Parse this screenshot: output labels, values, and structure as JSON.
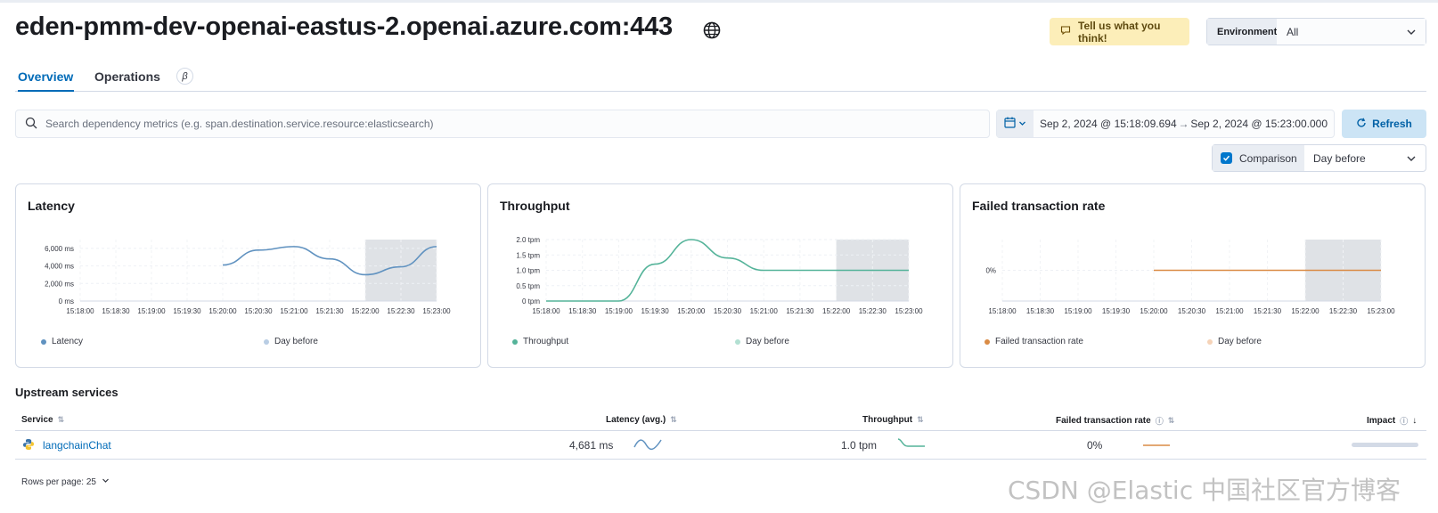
{
  "header": {
    "title": "eden-pmm-dev-openai-eastus-2.openai.azure.com:443",
    "feedback_label": "Tell us what you think!",
    "environment_label": "Environment",
    "environment_value": "All"
  },
  "tabs": [
    {
      "label": "Overview",
      "active": true
    },
    {
      "label": "Operations",
      "badge": "β"
    }
  ],
  "search": {
    "placeholder": "Search dependency metrics (e.g. span.destination.service.resource:elasticsearch)"
  },
  "date_range": {
    "start": "Sep 2, 2024 @ 15:18:09.694",
    "arrow": "→",
    "end": "Sep 2, 2024 @ 15:23:00.000"
  },
  "refresh_label": "Refresh",
  "comparison": {
    "label": "Comparison",
    "checked": true,
    "value": "Day before"
  },
  "chart_data": [
    {
      "type": "line",
      "title": "Latency",
      "x": [
        "15:18:00",
        "15:18:30",
        "15:19:00",
        "15:19:30",
        "15:20:00",
        "15:20:30",
        "15:21:00",
        "15:21:30",
        "15:22:00",
        "15:22:30",
        "15:23:00"
      ],
      "y_ticks": [
        "6,000 ms",
        "4,000 ms",
        "2,000 ms",
        "0 ms"
      ],
      "ylim": [
        0,
        7000
      ],
      "series": [
        {
          "name": "Latency",
          "color": "#6092c0",
          "points": [
            [
              4.0,
              4100
            ],
            [
              5.0,
              5800
            ],
            [
              6.0,
              6200
            ],
            [
              7.0,
              4800
            ],
            [
              8.0,
              3000
            ],
            [
              9.0,
              3900
            ],
            [
              10.0,
              6200
            ]
          ]
        },
        {
          "name": "Day before",
          "color": "#b9cde4",
          "points": []
        }
      ],
      "shaded_from": 8.0
    },
    {
      "type": "line",
      "title": "Throughput",
      "x": [
        "15:18:00",
        "15:18:30",
        "15:19:00",
        "15:19:30",
        "15:20:00",
        "15:20:30",
        "15:21:00",
        "15:21:30",
        "15:22:00",
        "15:22:30",
        "15:23:00"
      ],
      "y_ticks": [
        "2.0 tpm",
        "1.5 tpm",
        "1.0 tpm",
        "0.5 tpm",
        "0 tpm"
      ],
      "ylim": [
        0,
        2
      ],
      "series": [
        {
          "name": "Throughput",
          "color": "#54b399",
          "points": [
            [
              0,
              0
            ],
            [
              2.0,
              0
            ],
            [
              3.0,
              1.2
            ],
            [
              4.0,
              2.0
            ],
            [
              5.0,
              1.4
            ],
            [
              6.0,
              1.0
            ],
            [
              10.0,
              1.0
            ]
          ]
        },
        {
          "name": "Day before",
          "color": "#b2e0d2",
          "points": []
        }
      ],
      "shaded_from": 8.0
    },
    {
      "type": "line",
      "title": "Failed transaction rate",
      "x": [
        "15:18:00",
        "15:18:30",
        "15:19:00",
        "15:19:30",
        "15:20:00",
        "15:20:30",
        "15:21:00",
        "15:21:30",
        "15:22:00",
        "15:22:30",
        "15:23:00"
      ],
      "y_ticks": [
        "0%"
      ],
      "ylim": [
        -1,
        1
      ],
      "series": [
        {
          "name": "Failed transaction rate",
          "color": "#da8b45",
          "points": [
            [
              4.0,
              0
            ],
            [
              10.0,
              0
            ]
          ]
        },
        {
          "name": "Day before",
          "color": "#f6d3b8",
          "points": []
        }
      ],
      "shaded_from": 8.0
    }
  ],
  "upstream": {
    "title": "Upstream services",
    "columns": [
      "Service",
      "Latency (avg.)",
      "Throughput",
      "Failed transaction rate",
      "Impact"
    ],
    "rows": [
      {
        "service": "langchainChat",
        "latency": "4,681 ms",
        "throughput": "1.0 tpm",
        "failed_rate": "0%"
      }
    ]
  },
  "pagination": {
    "rows_per_page": "Rows per page: 25"
  },
  "watermark": "CSDN @Elastic 中国社区官方博客"
}
